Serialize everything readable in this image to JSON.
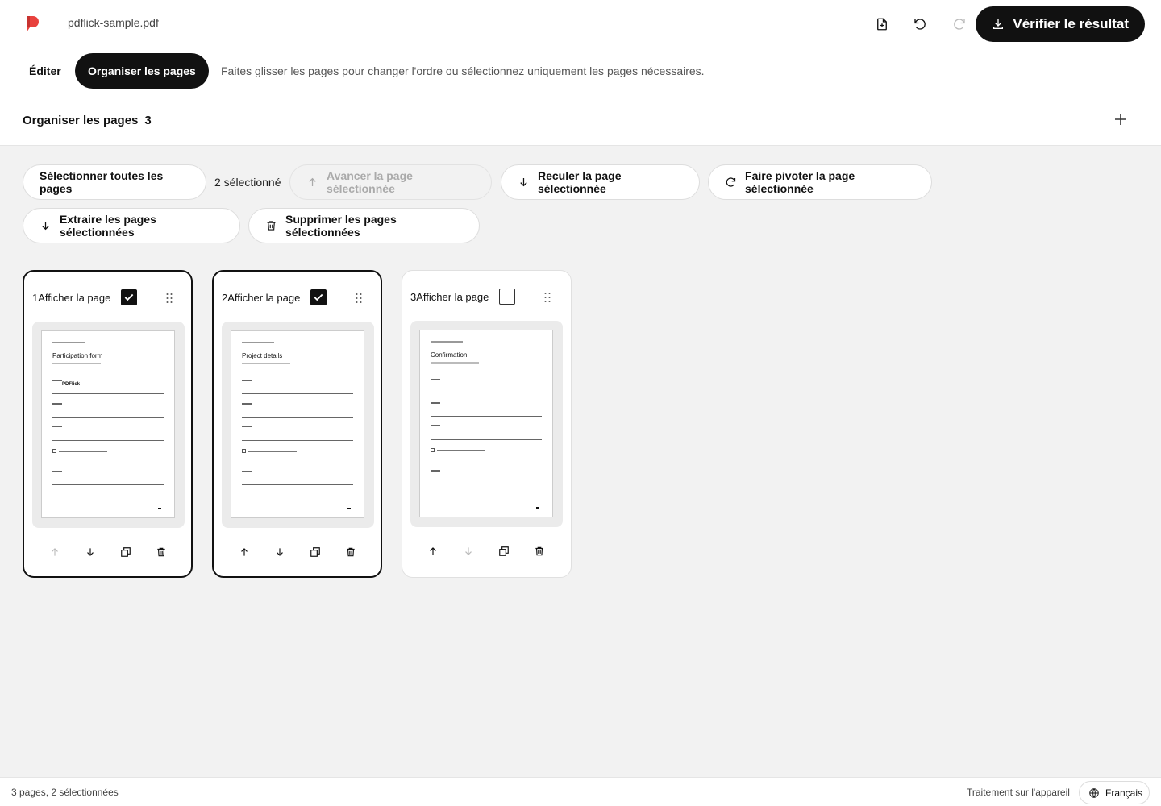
{
  "header": {
    "filename": "pdflick-sample.pdf",
    "primary_action": "Vérifier le résultat",
    "brand_color": "#e8413d"
  },
  "modes": {
    "edit_label": "Éditer",
    "organize_label": "Organiser les pages",
    "hint": "Faites glisser les pages pour changer l'ordre ou sélectionnez uniquement les pages nécessaires."
  },
  "section": {
    "title": "Organiser les pages",
    "count": "3"
  },
  "toolbar": {
    "select_all": "Sélectionner toutes les pages",
    "selected_count": "2 sélectionné",
    "move_forward": "Avancer la page sélectionnée",
    "move_back": "Reculer la page sélectionnée",
    "rotate": "Faire pivoter la page sélectionnée",
    "extract": "Extraire les pages sélectionnées",
    "delete": "Supprimer les pages sélectionnées"
  },
  "pages": [
    {
      "label": "1Afficher la page",
      "selected": true,
      "thumb_title": "Participation form",
      "thumb_value": "PDFlick"
    },
    {
      "label": "2Afficher la page",
      "selected": true,
      "thumb_title": "Project details",
      "thumb_value": ""
    },
    {
      "label": "3Afficher la page",
      "selected": false,
      "thumb_title": "Confirmation",
      "thumb_value": ""
    }
  ],
  "footer": {
    "status": "3 pages, 2 sélectionnées",
    "processing": "Traitement sur l'appareil",
    "language": "Français"
  }
}
